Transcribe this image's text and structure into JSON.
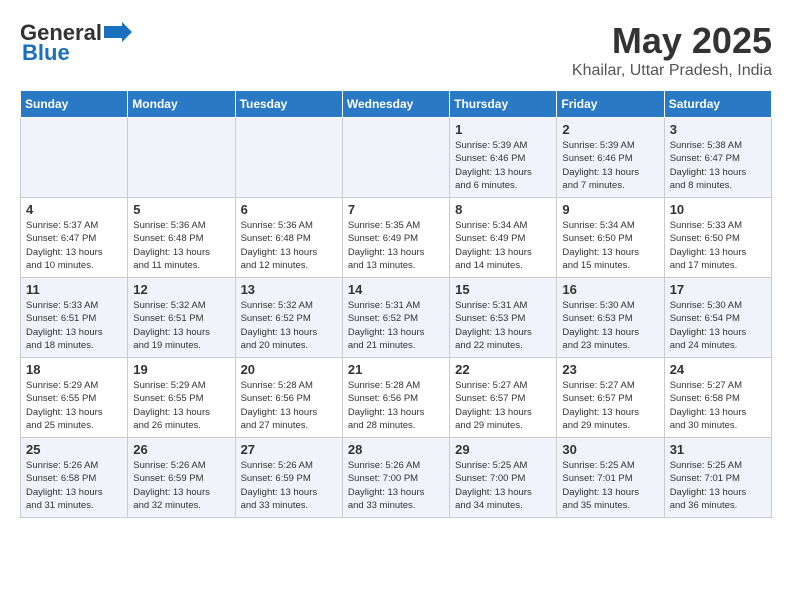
{
  "logo": {
    "general": "General",
    "blue": "Blue"
  },
  "title": "May 2025",
  "subtitle": "Khailar, Uttar Pradesh, India",
  "days_of_week": [
    "Sunday",
    "Monday",
    "Tuesday",
    "Wednesday",
    "Thursday",
    "Friday",
    "Saturday"
  ],
  "weeks": [
    [
      {
        "day": "",
        "content": ""
      },
      {
        "day": "",
        "content": ""
      },
      {
        "day": "",
        "content": ""
      },
      {
        "day": "",
        "content": ""
      },
      {
        "day": "1",
        "content": "Sunrise: 5:39 AM\nSunset: 6:46 PM\nDaylight: 13 hours\nand 6 minutes."
      },
      {
        "day": "2",
        "content": "Sunrise: 5:39 AM\nSunset: 6:46 PM\nDaylight: 13 hours\nand 7 minutes."
      },
      {
        "day": "3",
        "content": "Sunrise: 5:38 AM\nSunset: 6:47 PM\nDaylight: 13 hours\nand 8 minutes."
      }
    ],
    [
      {
        "day": "4",
        "content": "Sunrise: 5:37 AM\nSunset: 6:47 PM\nDaylight: 13 hours\nand 10 minutes."
      },
      {
        "day": "5",
        "content": "Sunrise: 5:36 AM\nSunset: 6:48 PM\nDaylight: 13 hours\nand 11 minutes."
      },
      {
        "day": "6",
        "content": "Sunrise: 5:36 AM\nSunset: 6:48 PM\nDaylight: 13 hours\nand 12 minutes."
      },
      {
        "day": "7",
        "content": "Sunrise: 5:35 AM\nSunset: 6:49 PM\nDaylight: 13 hours\nand 13 minutes."
      },
      {
        "day": "8",
        "content": "Sunrise: 5:34 AM\nSunset: 6:49 PM\nDaylight: 13 hours\nand 14 minutes."
      },
      {
        "day": "9",
        "content": "Sunrise: 5:34 AM\nSunset: 6:50 PM\nDaylight: 13 hours\nand 15 minutes."
      },
      {
        "day": "10",
        "content": "Sunrise: 5:33 AM\nSunset: 6:50 PM\nDaylight: 13 hours\nand 17 minutes."
      }
    ],
    [
      {
        "day": "11",
        "content": "Sunrise: 5:33 AM\nSunset: 6:51 PM\nDaylight: 13 hours\nand 18 minutes."
      },
      {
        "day": "12",
        "content": "Sunrise: 5:32 AM\nSunset: 6:51 PM\nDaylight: 13 hours\nand 19 minutes."
      },
      {
        "day": "13",
        "content": "Sunrise: 5:32 AM\nSunset: 6:52 PM\nDaylight: 13 hours\nand 20 minutes."
      },
      {
        "day": "14",
        "content": "Sunrise: 5:31 AM\nSunset: 6:52 PM\nDaylight: 13 hours\nand 21 minutes."
      },
      {
        "day": "15",
        "content": "Sunrise: 5:31 AM\nSunset: 6:53 PM\nDaylight: 13 hours\nand 22 minutes."
      },
      {
        "day": "16",
        "content": "Sunrise: 5:30 AM\nSunset: 6:53 PM\nDaylight: 13 hours\nand 23 minutes."
      },
      {
        "day": "17",
        "content": "Sunrise: 5:30 AM\nSunset: 6:54 PM\nDaylight: 13 hours\nand 24 minutes."
      }
    ],
    [
      {
        "day": "18",
        "content": "Sunrise: 5:29 AM\nSunset: 6:55 PM\nDaylight: 13 hours\nand 25 minutes."
      },
      {
        "day": "19",
        "content": "Sunrise: 5:29 AM\nSunset: 6:55 PM\nDaylight: 13 hours\nand 26 minutes."
      },
      {
        "day": "20",
        "content": "Sunrise: 5:28 AM\nSunset: 6:56 PM\nDaylight: 13 hours\nand 27 minutes."
      },
      {
        "day": "21",
        "content": "Sunrise: 5:28 AM\nSunset: 6:56 PM\nDaylight: 13 hours\nand 28 minutes."
      },
      {
        "day": "22",
        "content": "Sunrise: 5:27 AM\nSunset: 6:57 PM\nDaylight: 13 hours\nand 29 minutes."
      },
      {
        "day": "23",
        "content": "Sunrise: 5:27 AM\nSunset: 6:57 PM\nDaylight: 13 hours\nand 29 minutes."
      },
      {
        "day": "24",
        "content": "Sunrise: 5:27 AM\nSunset: 6:58 PM\nDaylight: 13 hours\nand 30 minutes."
      }
    ],
    [
      {
        "day": "25",
        "content": "Sunrise: 5:26 AM\nSunset: 6:58 PM\nDaylight: 13 hours\nand 31 minutes."
      },
      {
        "day": "26",
        "content": "Sunrise: 5:26 AM\nSunset: 6:59 PM\nDaylight: 13 hours\nand 32 minutes."
      },
      {
        "day": "27",
        "content": "Sunrise: 5:26 AM\nSunset: 6:59 PM\nDaylight: 13 hours\nand 33 minutes."
      },
      {
        "day": "28",
        "content": "Sunrise: 5:26 AM\nSunset: 7:00 PM\nDaylight: 13 hours\nand 33 minutes."
      },
      {
        "day": "29",
        "content": "Sunrise: 5:25 AM\nSunset: 7:00 PM\nDaylight: 13 hours\nand 34 minutes."
      },
      {
        "day": "30",
        "content": "Sunrise: 5:25 AM\nSunset: 7:01 PM\nDaylight: 13 hours\nand 35 minutes."
      },
      {
        "day": "31",
        "content": "Sunrise: 5:25 AM\nSunset: 7:01 PM\nDaylight: 13 hours\nand 36 minutes."
      }
    ]
  ]
}
